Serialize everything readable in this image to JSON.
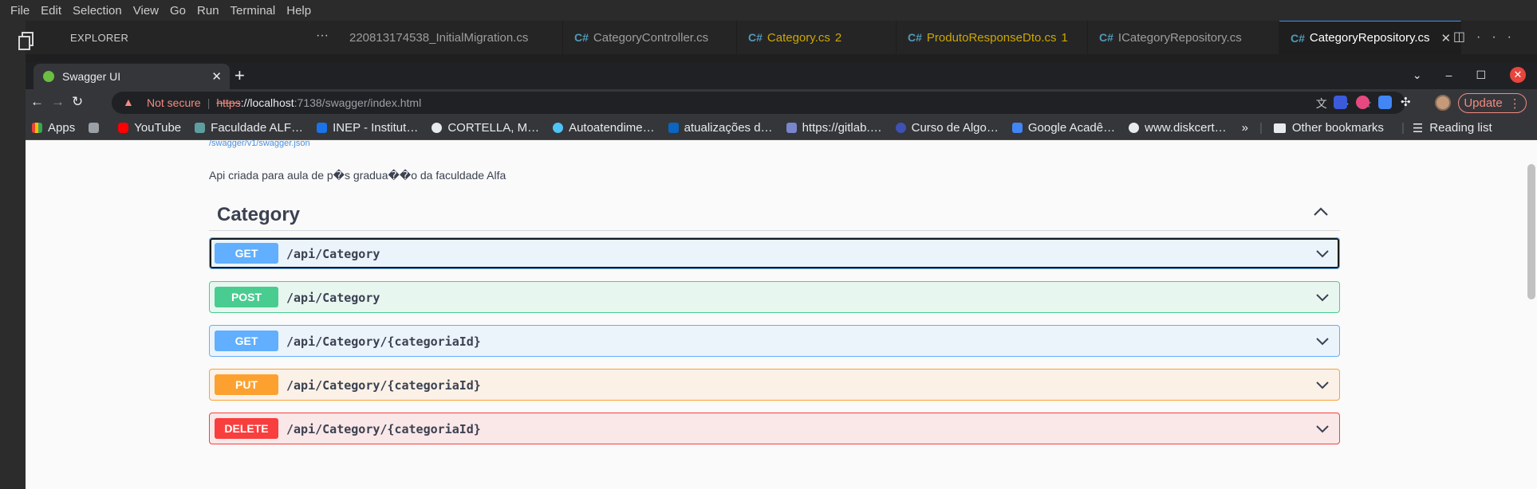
{
  "vscode": {
    "menu": [
      "File",
      "Edit",
      "Selection",
      "View",
      "Go",
      "Run",
      "Terminal",
      "Help"
    ],
    "explorer_label": "EXPLORER",
    "tabs": [
      {
        "label": "220813174538_InitialMigration.cs",
        "icon": "none",
        "badge": ""
      },
      {
        "label": "CategoryController.cs",
        "icon": "csharp-icon",
        "badge": ""
      },
      {
        "label": "Category.cs",
        "icon": "csharp-icon",
        "badge": "2"
      },
      {
        "label": "ProdutoResponseDto.cs",
        "icon": "csharp-icon",
        "badge": "1"
      },
      {
        "label": "ICategoryRepository.cs",
        "icon": "csharp-icon",
        "badge": ""
      },
      {
        "label": "CategoryRepository.cs",
        "icon": "csharp-icon",
        "badge": ""
      }
    ]
  },
  "browser": {
    "tab_title": "Swagger UI",
    "security_label": "Not secure",
    "url_scheme": "https",
    "url_host": "://localhost",
    "url_path": ":7138/swagger/index.html",
    "update_label": "Update",
    "bookmarks": [
      {
        "label": "Apps",
        "color": "#e8eaed"
      },
      {
        "label": "",
        "color": "#9aa0a6"
      },
      {
        "label": "YouTube",
        "color": "#ff0000"
      },
      {
        "label": "Faculdade ALF…",
        "color": "#5f9ea0"
      },
      {
        "label": "INEP - Institut…",
        "color": "#1a73e8"
      },
      {
        "label": "CORTELLA, M…",
        "color": "#e8eaed"
      },
      {
        "label": "Autoatendime…",
        "color": "#4fc3f7"
      },
      {
        "label": "atualizações d…",
        "color": "#0a66c2"
      },
      {
        "label": "https://gitlab.…",
        "color": "#7986cb"
      },
      {
        "label": "Curso de Algo…",
        "color": "#3f51b5"
      },
      {
        "label": "Google Acadê…",
        "color": "#4285f4"
      },
      {
        "label": "www.diskcert…",
        "color": "#e8eaed"
      }
    ],
    "other_bookmarks": "Other bookmarks",
    "reading_list": "Reading list"
  },
  "swagger": {
    "spec_link": "/swagger/v1/swagger.json",
    "description": "Api criada para aula de p�s gradua��o da faculdade Alfa",
    "tag": "Category",
    "operations": [
      {
        "method": "GET",
        "path": "/api/Category"
      },
      {
        "method": "POST",
        "path": "/api/Category"
      },
      {
        "method": "GET",
        "path": "/api/Category/{categoriaId}"
      },
      {
        "method": "PUT",
        "path": "/api/Category/{categoriaId}"
      },
      {
        "method": "DELETE",
        "path": "/api/Category/{categoriaId}"
      }
    ]
  },
  "colors": {
    "get": "#61affe",
    "post": "#49cc90",
    "put": "#fca130",
    "delete": "#f93e3e"
  }
}
